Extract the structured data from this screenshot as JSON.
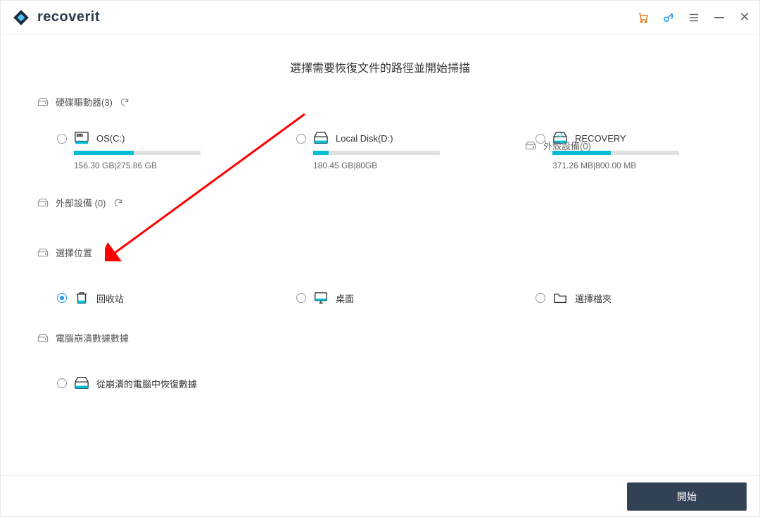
{
  "brand": {
    "name": "recoverit"
  },
  "titlebar": {},
  "page_title": "選擇需要恢復文件的路徑並開始掃描",
  "sections": {
    "hdd": {
      "label": "硬碟驅動器(3)"
    },
    "ext": {
      "label": "外部設備 (0)"
    },
    "external_inline": {
      "label": "外殼設備(0)"
    },
    "locations": {
      "label": "選擇位置"
    },
    "crash": {
      "label": "電腦崩潰數據數據"
    }
  },
  "drives": [
    {
      "name": "OS(C:)",
      "size_text": "156.30 GB|275.86 GB",
      "fill": 47
    },
    {
      "name": "Local Disk(D:)",
      "size_text": "180.45 GB|80GB",
      "fill": 12
    },
    {
      "name": "RECOVERY",
      "size_text": "371.26 MB|800.00 MB",
      "fill": 46
    }
  ],
  "locations": [
    {
      "id": "recycle",
      "label": "回收站",
      "selected": true
    },
    {
      "id": "desktop",
      "label": "桌面",
      "selected": false
    },
    {
      "id": "folder",
      "label": "選擇檔夾",
      "selected": false
    }
  ],
  "crash_option": {
    "label": "從崩潰的電腦中恢復數據"
  },
  "footer": {
    "start": "開始"
  }
}
